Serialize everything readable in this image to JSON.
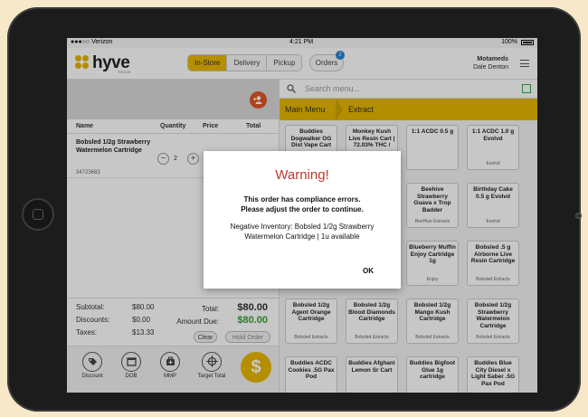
{
  "status_bar": {
    "carrier": "●●●○○ Verizon",
    "time": "4:21 PM",
    "battery": "100%"
  },
  "header": {
    "logo_text": "hyve",
    "logo_sub": "TECH",
    "modes": [
      "In-Store",
      "Delivery",
      "Pickup"
    ],
    "active_mode": "In-Store",
    "orders_label": "Orders",
    "orders_badge": "2",
    "store_name": "Motameds",
    "user_name": "Dale Denton"
  },
  "cart": {
    "columns": {
      "name": "Name",
      "quantity": "Quantity",
      "price": "Price",
      "total": "Total"
    },
    "items": [
      {
        "name": "Bobsled 1/2g Strawberry Watermelon Cartridge",
        "sku": "34723683",
        "qty": "2",
        "minus": "−",
        "plus": "+"
      }
    ],
    "subtotal_label": "Subtotal:",
    "subtotal": "$80.00",
    "discounts_label": "Discounts:",
    "discounts": "$0.00",
    "taxes_label": "Taxes:",
    "taxes": "$13.33",
    "total_label": "Total:",
    "total": "$80.00",
    "amount_due_label": "Amount Due:",
    "amount_due": "$80.00",
    "clear_label": "Clear",
    "hold_label": "Hold Order",
    "actions": [
      "Discount",
      "DOB",
      "MMP",
      "Target Total"
    ],
    "pay_symbol": "$"
  },
  "menu": {
    "search_placeholder": "Search menu...",
    "breadcrumb_main": "Main Menu",
    "breadcrumb_sub": "Extract",
    "tiles": [
      {
        "name": "Buddies Dogwalker OG Dist Vape Cart",
        "brand": ""
      },
      {
        "name": "Monkey Kush Live Resin Cart | 72.03% THC /",
        "brand": ""
      },
      {
        "name": "1:1 ACDC 0.5 g",
        "brand": ""
      },
      {
        "name": "1:1 ACDC 1.0 g Evolvd",
        "brand": "Evolvd"
      },
      {
        "name": "",
        "brand": ""
      },
      {
        "name": "",
        "brand": ""
      },
      {
        "name": "Beehive Strawberry Guava x Trop Badder",
        "brand": "BeeHive Extracts"
      },
      {
        "name": "Birthday Cake 0.5 g Evolvd",
        "brand": "Evolvd"
      },
      {
        "name": "",
        "brand": ""
      },
      {
        "name": "",
        "brand": ""
      },
      {
        "name": "Blueberry Muffin Enjoy Cartridge 1g",
        "brand": "Enjoy"
      },
      {
        "name": "Bobsled .5 g Airborne Live Resin Cartridge",
        "brand": "Bobsled Extracts"
      },
      {
        "name": "Bobsled 1/2g Agent Orange Cartridge",
        "brand": "Bobsled Extracts"
      },
      {
        "name": "Bobsled 1/2g Blood Diamonds Cartridge",
        "brand": "Bobsled Extracts"
      },
      {
        "name": "Bobsled 1/2g Mango Kush Cartridge",
        "brand": "Bobsled Extracts"
      },
      {
        "name": "Bobsled 1/2g Strawberry Watermelon Cartridge",
        "brand": "Bobsled Extracts"
      },
      {
        "name": "Buddies ACDC Cookies .5G Pax Pod",
        "brand": ""
      },
      {
        "name": "Buddies Afghani Lemon Sr Cart",
        "brand": ""
      },
      {
        "name": "Buddies Bigfoot Glue 1g cartridge",
        "brand": ""
      },
      {
        "name": "Buddies Blue City Diesel x Light Saber .5G Pax Pod",
        "brand": ""
      }
    ]
  },
  "dialog": {
    "title": "Warning!",
    "message_line1": "This order has compliance errors.",
    "message_line2": "Please adjust the order to continue.",
    "detail": "Negative Inventory: Bobsled 1/2g Strawberry Watermelon Cartridge | 1u available",
    "ok_label": "OK"
  },
  "colors": {
    "accent": "#e6b800",
    "warning": "#c0392b",
    "amount_due": "#3a9b3a",
    "customer_button": "#e0552a"
  }
}
